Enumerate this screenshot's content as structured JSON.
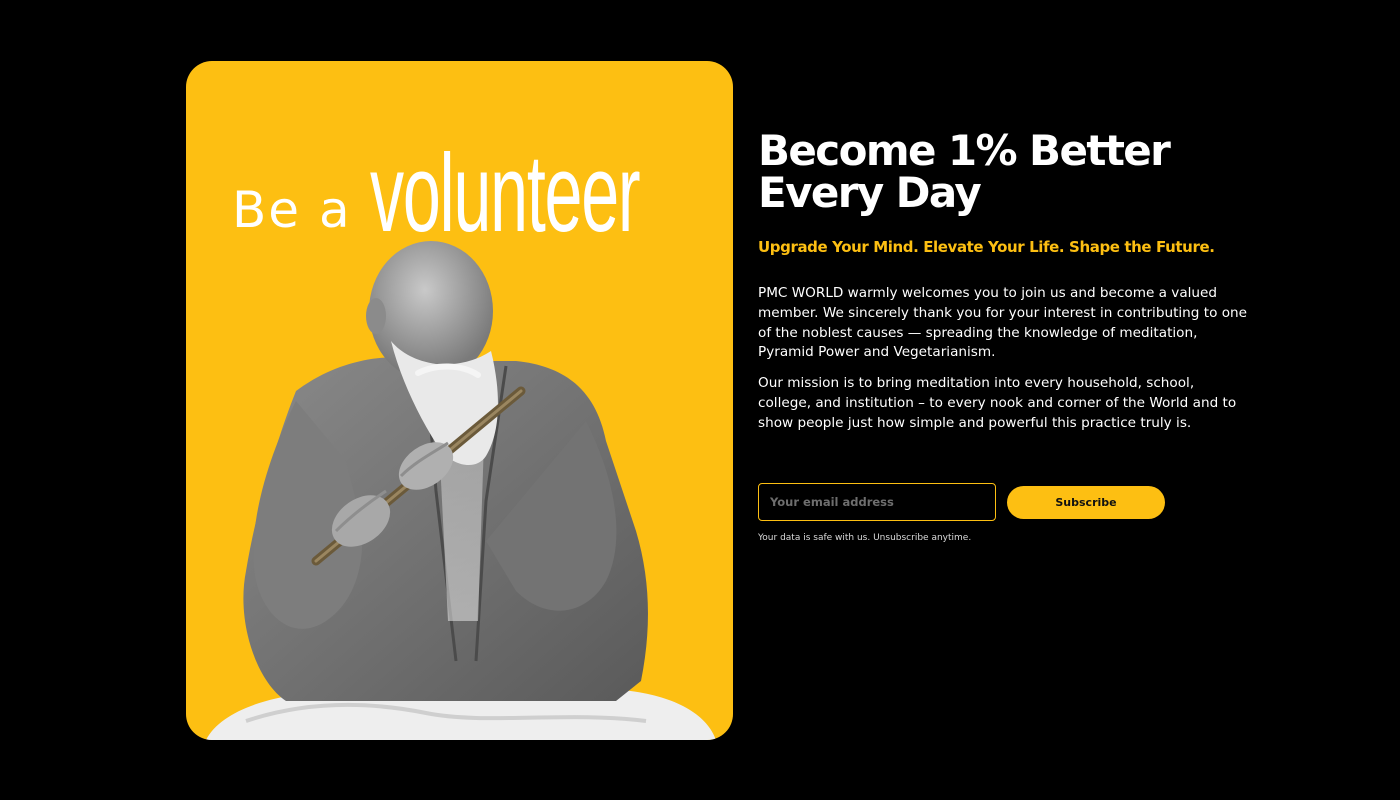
{
  "hero": {
    "be_a": "Be a",
    "volunteer": "volunteer",
    "image_description_icon": "flute-player-photo"
  },
  "content": {
    "title_line1": "Become 1% Better",
    "title_line2": "Every Day",
    "tagline": "Upgrade Your Mind. Elevate Your Life. Shape the Future.",
    "paragraph1": "PMC WORLD warmly welcomes you to join us and become a valued member. We sincerely thank you for your interest in contributing to one of the noblest causes — spreading the knowledge of meditation, Pyramid Power and Vegetarianism.",
    "paragraph2": "Our mission is to bring meditation into every household, school, college, and institution – to every nook and corner of the World and to show people just how simple and powerful this practice truly is."
  },
  "form": {
    "email_placeholder": "Your email address",
    "email_value": "",
    "subscribe_label": "Subscribe",
    "privacy_note": "Your data is safe with us. Unsubscribe anytime."
  },
  "colors": {
    "accent": "#FDBF12",
    "background": "#000000",
    "text": "#FFFFFF"
  }
}
